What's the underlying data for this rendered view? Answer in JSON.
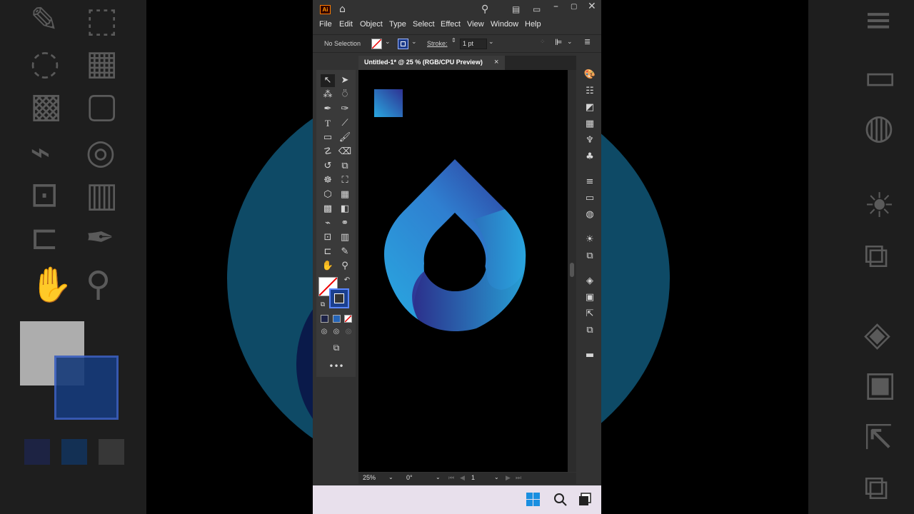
{
  "app": {
    "logo": "Ai",
    "menu": [
      "File",
      "Edit",
      "Object",
      "Type",
      "Select",
      "Effect",
      "View",
      "Window",
      "Help"
    ]
  },
  "control_bar": {
    "selection": "No Selection",
    "stroke_label": "Stroke:",
    "stroke_weight": "1 pt"
  },
  "document": {
    "tab_title": "Untitled-1* @ 25 % (RGB/CPU Preview)",
    "close_symbol": "×"
  },
  "status_bar": {
    "zoom": "25%",
    "rotation": "0°",
    "artboard": "1"
  },
  "artwork": {
    "gradient_start": "#29a8e0",
    "gradient_end": "#2e3192",
    "canvas_color": "#000000"
  },
  "icons": {
    "home": "home-icon",
    "search": "search-icon",
    "arrange": "arrange-documents-icon",
    "minimize": "minimize-icon",
    "maximize": "maximize-icon",
    "close": "close-icon",
    "windows": "windows-start-icon"
  }
}
